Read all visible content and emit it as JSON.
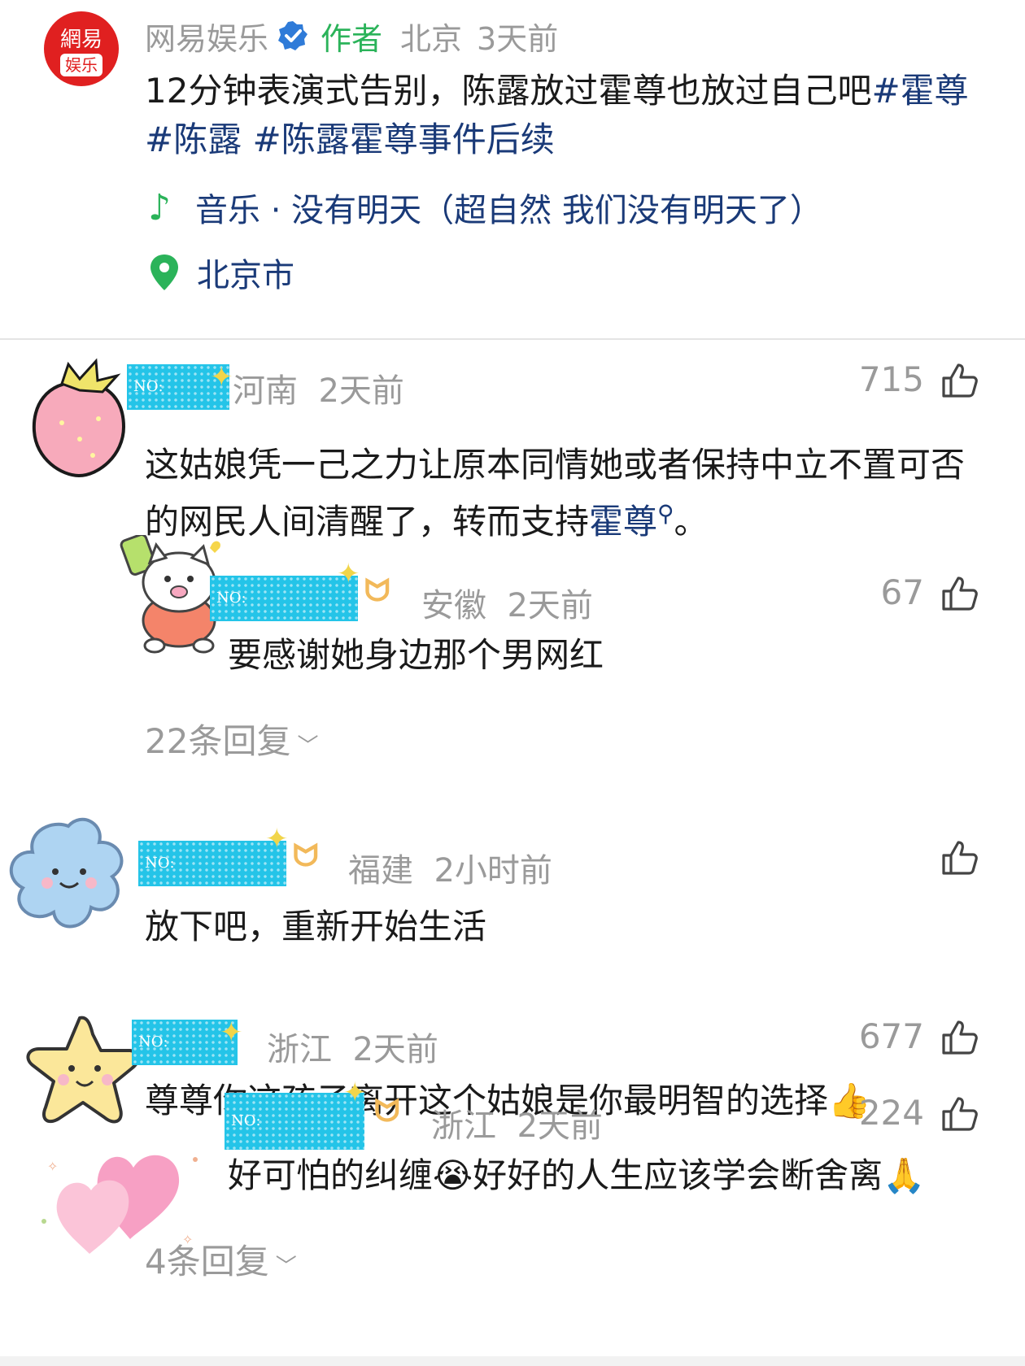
{
  "post": {
    "account_name": "网易娱乐",
    "logo_top": "網易",
    "logo_bottom": "娱乐",
    "author_tag": "作者",
    "location": "北京",
    "time": "3天前",
    "title_text": "12分钟表演式告别，陈露放过霍尊也放过自己吧",
    "tags": "#霍尊 #陈露 #陈露霍尊事件后续",
    "music": "音乐 · 没有明天（超自然 我们没有明天了）",
    "place": "北京市"
  },
  "comments": [
    {
      "badge": "NO:",
      "region": "河南",
      "time": "2天前",
      "likes": "715",
      "text_before": "这姑娘凭一己之力让原本同情她或者保持中立不置可否的网民人间清醒了，转而支持",
      "link": "霍尊",
      "text_after": "。",
      "reply": {
        "badge": "NO:",
        "region": "安徽",
        "time": "2天前",
        "likes": "67",
        "text": "要感谢她身边那个男网红"
      },
      "reply_count": "22条回复"
    },
    {
      "badge": "NO:",
      "region": "福建",
      "time": "2小时前",
      "likes": "",
      "text": "放下吧，重新开始生活"
    },
    {
      "badge": "NO:",
      "region": "浙江",
      "time": "2天前",
      "likes": "677",
      "text": "尊尊你这孩子离开这个姑娘是你最明智的选择👍",
      "reply": {
        "badge": "NO:",
        "region": "浙江",
        "time": "2天前",
        "likes": "224",
        "text": "好可怕的纠缠😭好好的人生应该学会断舍离🙏"
      },
      "reply_count": "4条回复"
    }
  ],
  "colors": {
    "author_green": "#2bb35a",
    "link_blue": "#1a3a78",
    "meta_gray": "#9a9a9a",
    "logo_red": "#e02020",
    "badge_cyan": "#24c4e8"
  },
  "icons": [
    "verified-icon",
    "music-note-icon",
    "location-pin-icon",
    "thumbs-up-icon",
    "chevron-down-icon",
    "search-icon"
  ]
}
